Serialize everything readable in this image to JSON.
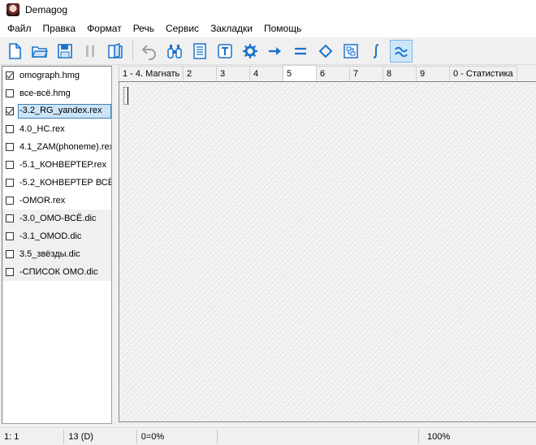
{
  "window": {
    "title": "Demagog"
  },
  "menu": [
    "Файл",
    "Правка",
    "Формат",
    "Речь",
    "Сервис",
    "Закладки",
    "Помощь"
  ],
  "toolbar": {
    "buttons": [
      {
        "icon": "new-document-icon"
      },
      {
        "icon": "open-folder-icon"
      },
      {
        "icon": "save-icon"
      },
      {
        "icon": "pause-icon"
      },
      {
        "icon": "book-icon"
      },
      {
        "icon": "undo-icon"
      },
      {
        "icon": "binoculars-icon"
      },
      {
        "icon": "page-lines-icon"
      },
      {
        "icon": "text-t-icon"
      },
      {
        "icon": "gear-icon"
      },
      {
        "icon": "arrow-right-icon"
      },
      {
        "icon": "equals-icon"
      },
      {
        "icon": "diamond-icon"
      },
      {
        "icon": "convert-icon"
      },
      {
        "icon": "integral-icon"
      },
      {
        "icon": "approx-icon",
        "active": true
      }
    ],
    "accent": "#1a73c9"
  },
  "files": [
    {
      "label": "omograph.hmg",
      "checked": true,
      "selected": false,
      "grey": false
    },
    {
      "label": "все-всё.hmg",
      "checked": false,
      "selected": false,
      "grey": false
    },
    {
      "label": "-3.2_RG_yandex.rex",
      "checked": true,
      "selected": true,
      "grey": false
    },
    {
      "label": "4.0_НС.rex",
      "checked": false,
      "selected": false,
      "grey": false
    },
    {
      "label": "4.1_ZAM(phoneme).rex",
      "checked": false,
      "selected": false,
      "grey": false
    },
    {
      "label": "-5.1_КОНВЕРТЕР.rex",
      "checked": false,
      "selected": false,
      "grey": false
    },
    {
      "label": "-5.2_КОНВЕРТЕР ВСЁ.",
      "checked": false,
      "selected": false,
      "grey": false
    },
    {
      "label": "-OMOR.rex",
      "checked": false,
      "selected": false,
      "grey": false
    },
    {
      "label": "-3.0_ОМО-ВСЁ.dic",
      "checked": false,
      "selected": false,
      "grey": true
    },
    {
      "label": "-3.1_OMOD.dic",
      "checked": false,
      "selected": false,
      "grey": true
    },
    {
      "label": "3.5_звёзды.dic",
      "checked": false,
      "selected": false,
      "grey": true
    },
    {
      "label": "-СПИСОК ОМО.dic",
      "checked": false,
      "selected": false,
      "grey": true
    }
  ],
  "tabs": [
    {
      "label": "1 - 4. Магнать",
      "active": false
    },
    {
      "label": "2",
      "active": false
    },
    {
      "label": "3",
      "active": false
    },
    {
      "label": "4",
      "active": false
    },
    {
      "label": "5",
      "active": true
    },
    {
      "label": "6",
      "active": false
    },
    {
      "label": "7",
      "active": false
    },
    {
      "label": "8",
      "active": false
    },
    {
      "label": "9",
      "active": false
    },
    {
      "label": "0 - Статистика",
      "active": false
    }
  ],
  "status": {
    "position": "1: 1",
    "count": "13 (D)",
    "ratio": "0=0%",
    "empty1": "",
    "empty2": "",
    "zoom": "100%"
  }
}
